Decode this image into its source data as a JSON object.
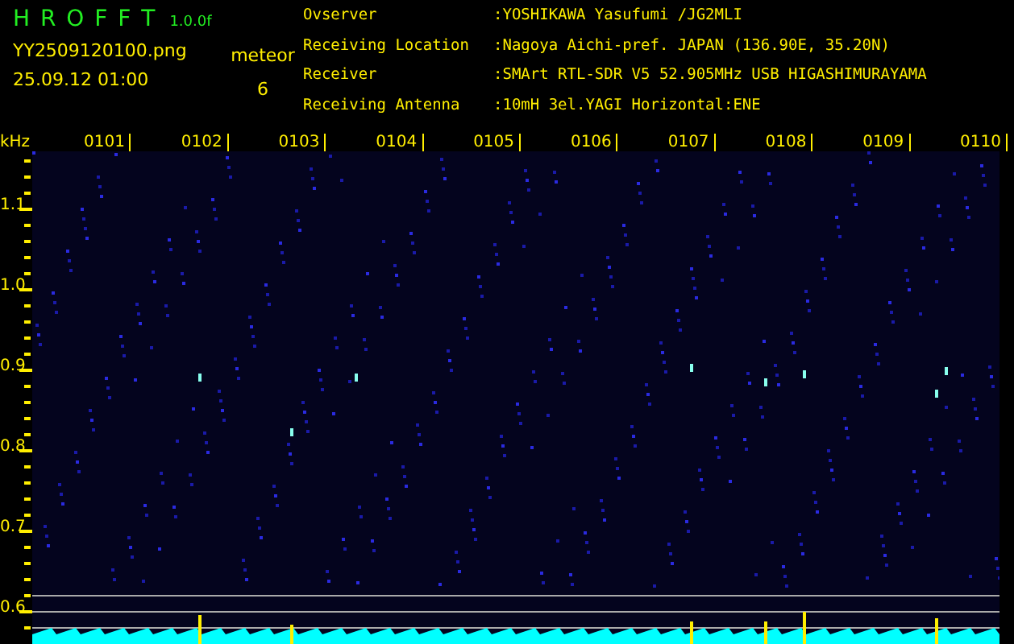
{
  "app": {
    "title": "H R O F F T",
    "version": "1.0.0f",
    "filename": "YY2509120100.png",
    "datetime": "25.09.12 01:00",
    "mode_label": "meteor",
    "count": "6"
  },
  "station": [
    {
      "label": "Ovserver",
      "value": ":YOSHIKAWA Yasufumi /JG2MLI"
    },
    {
      "label": "Receiving Location",
      "value": ":Nagoya Aichi-pref. JAPAN (136.90E, 35.20N)"
    },
    {
      "label": "Receiver",
      "value": ":SMArt RTL-SDR V5 52.905MHz USB HIGASHIMURAYAMA"
    },
    {
      "label": "Receiving Antenna",
      "value": ":10mH 3el.YAGI Horizontal:ENE"
    }
  ],
  "y_axis": {
    "unit": "kHz",
    "labels": [
      "1.1",
      "1.0",
      "0.9",
      "0.8",
      "0.7",
      "0.6"
    ]
  },
  "time_labels": [
    "0101",
    "0102",
    "0103",
    "0104",
    "0105",
    "0106",
    "0107",
    "0108",
    "0109",
    "0110"
  ]
}
